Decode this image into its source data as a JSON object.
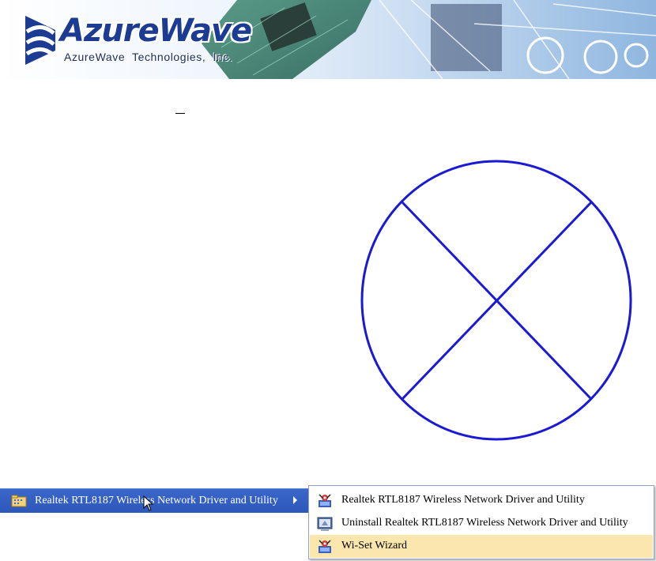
{
  "header": {
    "brand_name": "AzureWave",
    "brand_subtitle": "AzureWave  Technologies,  Inc.",
    "colors": {
      "brand_blue": "#1c3c93",
      "banner_light": "#e7f1fb",
      "banner_dark": "#7aa9d8"
    }
  },
  "placeholder": {
    "icon": "broken-image-circle-x",
    "stroke_color": "#1a1ad6"
  },
  "programs_menu": {
    "folder_icon": "program-folder-icon",
    "label": "Realtek RTL8187 Wireless Network Driver and Utility",
    "bg_color": "#3060c8"
  },
  "submenu": {
    "items": [
      {
        "icon": "utility-app-icon",
        "label": "Realtek RTL8187 Wireless Network Driver and Utility"
      },
      {
        "icon": "uninstall-icon",
        "label": "Uninstall Realtek RTL8187 Wireless Network Driver and Utility"
      },
      {
        "icon": "wizard-app-icon",
        "label": "Wi-Set Wizard",
        "highlighted": true
      }
    ],
    "highlight_color": "#fbe7ad"
  }
}
